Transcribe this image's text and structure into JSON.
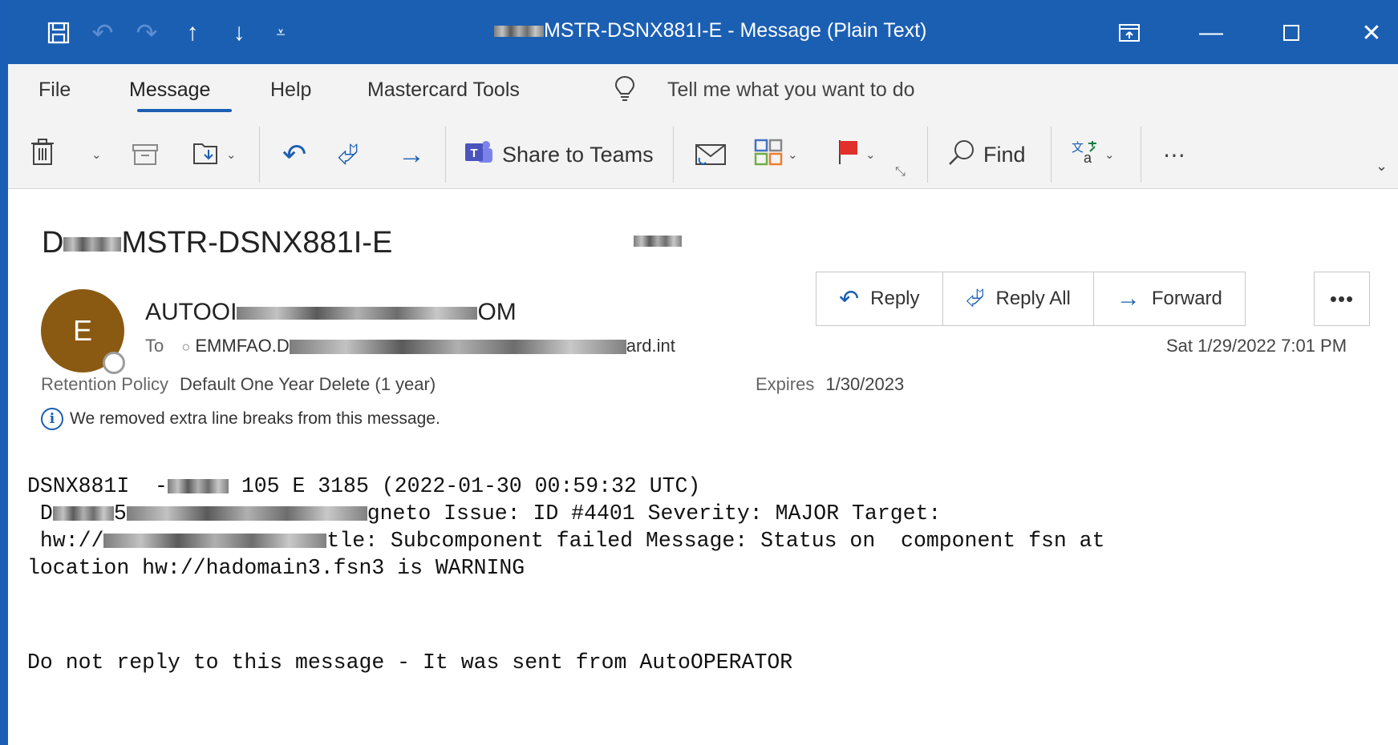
{
  "titlebar": {
    "title_suffix": "MSTR-DSNX881I-E  -  Message (Plain Text)",
    "icons": [
      "save-icon",
      "undo-icon",
      "redo-icon",
      "up-arrow-icon",
      "down-arrow-icon",
      "customize-icon",
      "ribbon-display-icon",
      "minimize-icon",
      "maximize-icon",
      "close-icon"
    ]
  },
  "menu": {
    "tabs": [
      "File",
      "Message",
      "Help",
      "Mastercard Tools"
    ],
    "active": "Message",
    "tell_me": "Tell me what you want to do"
  },
  "ribbon": {
    "share_teams": "Share to Teams",
    "find": "Find"
  },
  "message": {
    "subject_suffix": "MSTR-DSNX881I-E",
    "avatar_letter": "E",
    "sender_prefix": "AUTOOI",
    "sender_suffix": "OM",
    "to_label": "To",
    "to_prefix": "EMMFAO.D",
    "to_suffix": "ard.int",
    "datetime": "Sat 1/29/2022 7:01 PM",
    "retention_label": "Retention Policy",
    "retention_value": "Default One Year Delete (1 year)",
    "expires_label": "Expires",
    "expires_value": "1/30/2023",
    "info_text": "We removed extra line breaks from this message.",
    "actions": {
      "reply": "Reply",
      "reply_all": "Reply All",
      "forward": "Forward"
    }
  },
  "body": {
    "line1_a": "DSNX881I  -",
    "line1_b": " 105 E 3185 (2022-01-30 00:59:32 UTC)",
    "line2_a": " D",
    "line2_b": "5",
    "line2_c": "gneto Issue: ID #4401 Severity: MAJOR Target:",
    "line3_a": " hw://",
    "line3_b": "tle: Subcomponent failed Message: Status on  component fsn at",
    "line4": "location hw://hadomain3.fsn3 is WARNING",
    "footer": "Do not reply to this message - It was sent from AutoOPERATOR"
  },
  "colors": {
    "titlebar": "#1b5fb3",
    "accent": "#1b5fb3",
    "avatar": "#8a5a12",
    "flag": "#e0302a"
  }
}
